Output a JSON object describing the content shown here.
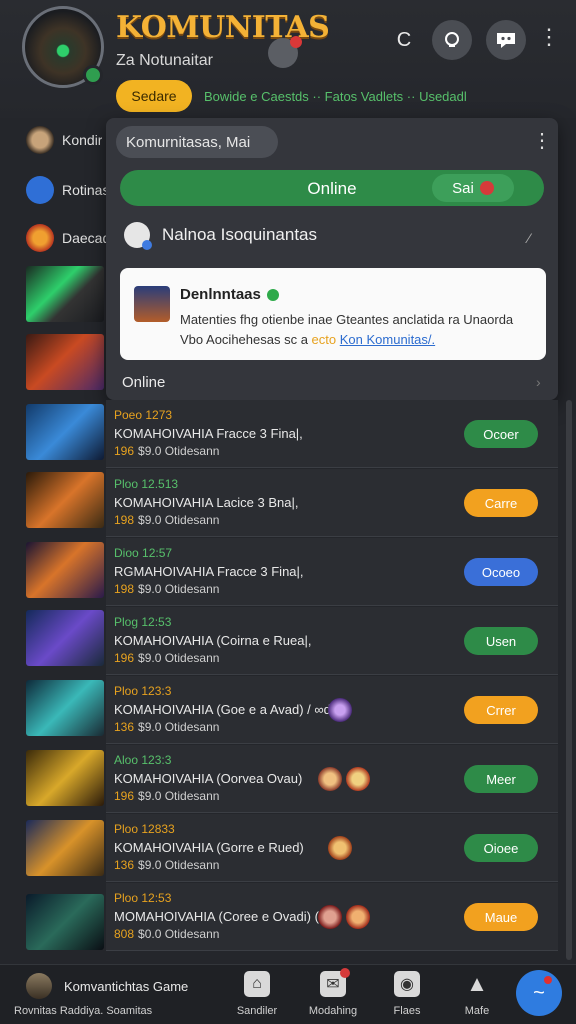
{
  "header": {
    "title": "KOMUNITAS",
    "subtitle": "Za Notunaitar",
    "chip_label": "Sedare",
    "ticker": "Bowide e Caestds ·· Fatos Vadlets ·· Usedadl",
    "refresh_glyph": "C"
  },
  "sidebar": {
    "items": [
      {
        "label": "Kondir"
      },
      {
        "label": "Rotinas"
      },
      {
        "label": "Daecado"
      }
    ]
  },
  "panel": {
    "search_value": "Komurnitasas, Mai",
    "online_label": "Online",
    "set_label": "Sai",
    "section_title": "Nalnoa Isoquinantas",
    "notice": {
      "name": "Denlnntaas",
      "text_part1": "Matenties fhg otienbe inae Gteantes anclatida ra Unaorda Vbo Aocihehesas sc a",
      "text_highlight": "ecto",
      "link": "Kon Komunitas/."
    },
    "footer_label": "Online"
  },
  "list": [
    {
      "l1": "Poeo 1273",
      "l2": "KOMAHOIVAHIA Fracce 3 Fina|,",
      "n": "196",
      "l3": "$9.0 Otidesann",
      "action": "Ocoer",
      "color": "#2e8b48",
      "l1color": "#e7a21f"
    },
    {
      "l1": "Ploo 12.513",
      "l2": "KOMAHOIVAHIA Lacice 3 Bna|,",
      "n": "198",
      "l3": "$9.0 Otidesann",
      "action": "Carre",
      "color": "#f2a11f",
      "l1color": "#57c06b"
    },
    {
      "l1": "Dioo 12:57",
      "l2": "RGMAHOIVAHIA Fracce 3 Fina|,",
      "n": "198",
      "l3": "$9.0 Otidesann",
      "action": "Ocoeo",
      "color": "#3a6fd8",
      "l1color": "#57c06b"
    },
    {
      "l1": "Plog 12:53",
      "l2": "KOMAHOIVAHIA (Coirna e Ruea|,",
      "n": "196",
      "l3": "$9.0 Otidesann",
      "action": "Usen",
      "color": "#2e8b48",
      "l1color": "#57c06b"
    },
    {
      "l1": "Ploo 123:3",
      "l2": "KOMAHOIVAHIA (Goe e a Avad) / ∞d",
      "n": "136",
      "l3": "$9.0 Otidesann",
      "action": "Crrer",
      "color": "#f2a11f",
      "l1color": "#e7a21f"
    },
    {
      "l1": "Aloo 123:3",
      "l2": "KOMAHOIVAHIA (Oorvea Ovau)",
      "n": "196",
      "l3": "$9.0 Otidesann",
      "action": "Meer",
      "color": "#2e8b48",
      "l1color": "#57c06b"
    },
    {
      "l1": "Ploo 12833",
      "l2": "KOMAHOIVAHIA (Gorre e Rued)",
      "n": "136",
      "l3": "$9.0 Otidesann",
      "action": "Oioee",
      "color": "#2e8b48",
      "l1color": "#e7a21f"
    },
    {
      "l1": "Ploo 12:53",
      "l2": "MOMAHOIVAHIA (Coree e Ovadi) (3",
      "n": "808",
      "l3": "$0.0 Otidesann",
      "action": "Maue",
      "color": "#f2a11f",
      "l1color": "#e7a21f"
    }
  ],
  "bottom": {
    "title": "Komvantichtas Game",
    "sub": "Rovnitas  Raddiya. Soamitas",
    "nav": [
      {
        "label": "Sandiler",
        "icon": "home-icon"
      },
      {
        "label": "Modahing",
        "icon": "message-icon"
      },
      {
        "label": "Flaes",
        "icon": "game-icon"
      },
      {
        "label": "Mafe",
        "icon": "warning-icon"
      }
    ]
  }
}
